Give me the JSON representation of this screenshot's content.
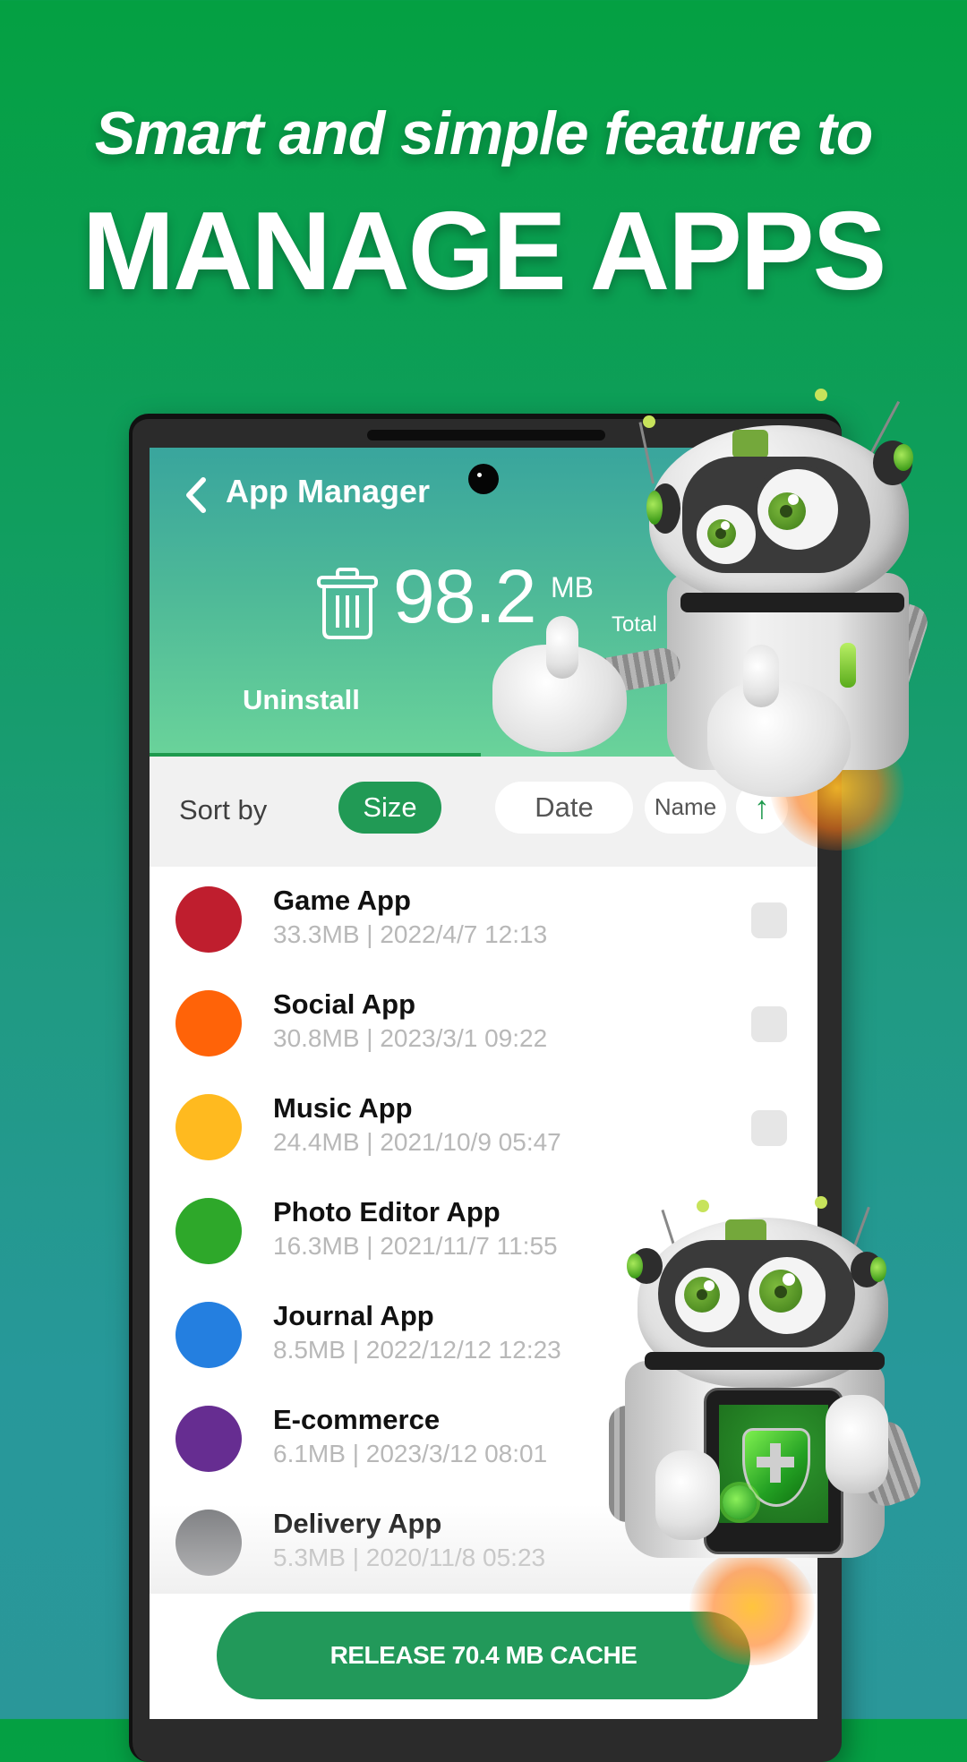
{
  "promo": {
    "tagline": "Smart and simple feature to",
    "headline": "MANAGE APPS"
  },
  "app": {
    "title": "App Manager",
    "back_icon": "chevron-left-icon",
    "summary": {
      "icon": "trash-icon",
      "value": "98.2",
      "unit": "MB",
      "label": "Total"
    },
    "tabs": [
      {
        "label": "Uninstall",
        "active": true
      }
    ],
    "sort": {
      "label": "Sort by",
      "options": [
        {
          "label": "Size",
          "selected": true
        },
        {
          "label": "Date",
          "selected": false
        },
        {
          "label": "Name",
          "selected": false
        }
      ],
      "order_icon": "arrow-up-icon",
      "order_symbol": "↑"
    },
    "apps": [
      {
        "name": "Game App",
        "meta": "33.3MB | 2022/4/7 12:13",
        "color": "#bf1e2e",
        "checkbox_visible": true,
        "checked": false
      },
      {
        "name": "Social App",
        "meta": "30.8MB | 2023/3/1 09:22",
        "color": "#ff6308",
        "checkbox_visible": true,
        "checked": false
      },
      {
        "name": "Music App",
        "meta": "24.4MB | 2021/10/9 05:47",
        "color": "#ffba1f",
        "checkbox_visible": true,
        "checked": false
      },
      {
        "name": "Photo Editor App",
        "meta": "16.3MB | 2021/11/7 11:55",
        "color": "#2ea82a",
        "checkbox_visible": false,
        "checked": false
      },
      {
        "name": "Journal App",
        "meta": "8.5MB | 2022/12/12 12:23",
        "color": "#247fe0",
        "checkbox_visible": false,
        "checked": false
      },
      {
        "name": "E-commerce",
        "meta": "6.1MB | 2023/3/12 08:01",
        "color": "#662d91",
        "checkbox_visible": false,
        "checked": false
      },
      {
        "name": "Delivery App",
        "meta": "5.3MB | 2020/11/8 05:23",
        "color": "#7d7e81",
        "checkbox_visible": false,
        "checked": false
      }
    ],
    "release_button": "RELEASE 70.4 MB CACHE"
  },
  "colors": {
    "accent": "#22995a",
    "background_top": "#04a042",
    "background_bottom": "#2a9799",
    "header_top": "#39a59d",
    "header_bottom": "#6ad39a"
  }
}
